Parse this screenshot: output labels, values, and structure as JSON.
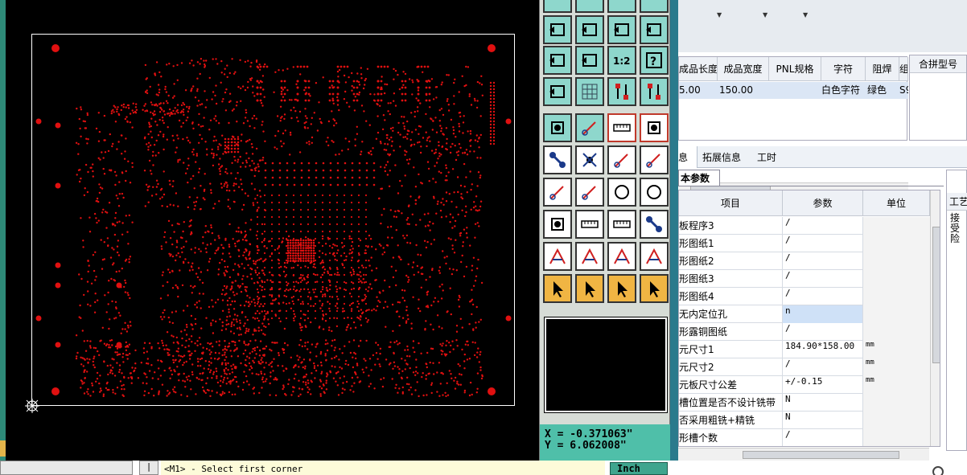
{
  "cam": {
    "command_prompt": "<M1> - Select first corner",
    "units_button": "Inch",
    "cmd_button_glyph": "|",
    "coord_x": "X = -0.371063\"",
    "coord_y": "Y = 6.062008\"",
    "colors": {
      "background": "#000000",
      "pads": "#e01010",
      "toolbar_teal": "#8ed7cc",
      "accent_teal": "#4fbfa9"
    }
  },
  "toolbar": {
    "icons": [
      "move-left-icon",
      "move-right-icon",
      "copy-icon",
      "mirror-icon",
      "fit-zoom-icon",
      "zoom-center-icon",
      "scale-1-2-icon",
      "query-icon",
      "palette-icon",
      "grid-icon",
      "layers-icon",
      "layers-alt-icon",
      "pad-icon",
      "rectangle-icon",
      "ruler-icon",
      "circle-pad-icon",
      "connect-icon",
      "delete-net-icon",
      "point-arrow-icon",
      "line-arrow-icon",
      "angle-icon",
      "diagonal-icon",
      "arc-icon",
      "rotate-icon",
      "snap-pad-icon",
      "dash-icon",
      "measure-icon",
      "group-icon",
      "triangle-icon",
      "peak-icon",
      "bridge-icon",
      "bridge-alt-icon",
      "select-pointer-icon",
      "select-box-icon",
      "select-circle-icon",
      "select-path-icon"
    ],
    "scale_label": "1:2",
    "query_label": "?"
  },
  "grid1": {
    "headers": [
      "成品长度",
      "成品宽度",
      "PNL规格",
      "字符",
      "阻焊",
      "组"
    ],
    "row": [
      "5.00",
      "150.00",
      "",
      "白色字符",
      "绿色",
      "S9"
    ],
    "side_header": "合拼型号"
  },
  "tabs": [
    "息",
    "拓展信息",
    "工时"
  ],
  "sub_tab": "本参数",
  "grid2": {
    "headers": [
      "项目",
      "参数",
      "单位"
    ],
    "rows": [
      {
        "item": "板程序3",
        "value": "/",
        "unit": ""
      },
      {
        "item": "形图纸1",
        "value": "/",
        "unit": ""
      },
      {
        "item": "形图纸2",
        "value": "/",
        "unit": ""
      },
      {
        "item": "形图纸3",
        "value": "/",
        "unit": ""
      },
      {
        "item": "形图纸4",
        "value": "/",
        "unit": ""
      },
      {
        "item": "无内定位孔",
        "value": "n",
        "unit": ""
      },
      {
        "item": "形露铜图纸",
        "value": "/",
        "unit": ""
      },
      {
        "item": "元尺寸1",
        "value": "184.90*158.00",
        "unit": "mm"
      },
      {
        "item": "元尺寸2",
        "value": "/",
        "unit": "mm"
      },
      {
        "item": "元板尺寸公差",
        "value": "+/-0.15",
        "unit": "mm"
      },
      {
        "item": "槽位置是否不设计铣带",
        "value": "N",
        "unit": ""
      },
      {
        "item": "否采用粗铣+精铣",
        "value": "N",
        "unit": ""
      },
      {
        "item": "形槽个数",
        "value": "/",
        "unit": ""
      }
    ]
  },
  "side3": {
    "header": "工艺",
    "text": "接受险"
  }
}
